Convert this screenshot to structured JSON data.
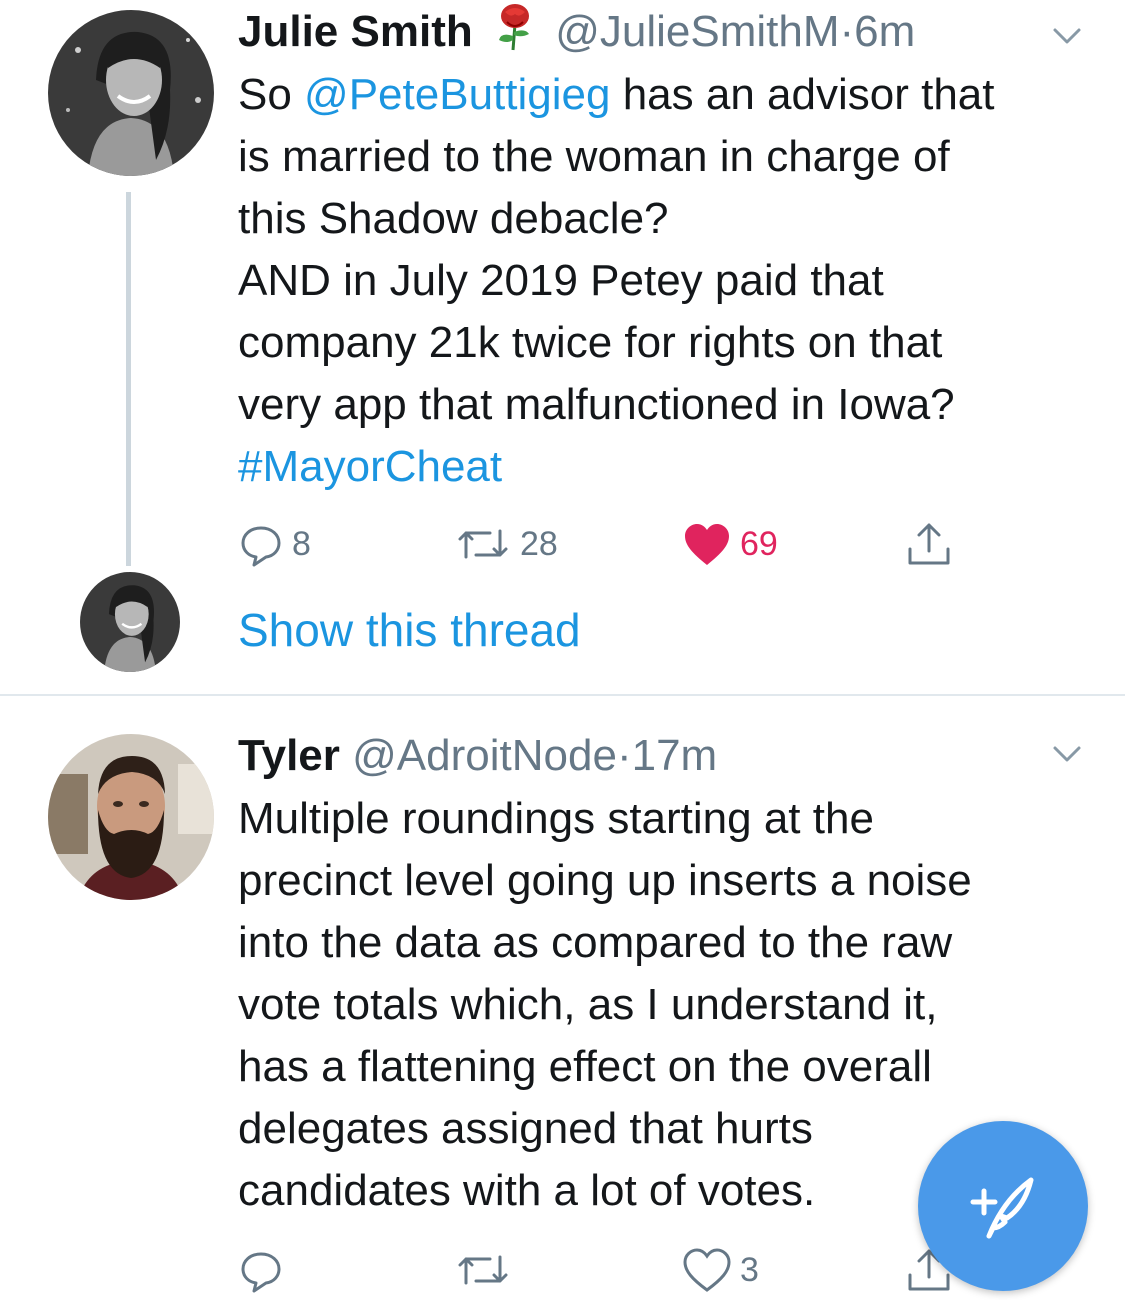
{
  "tweet1": {
    "name": "Julie Smith",
    "name_emoji": "rose-emoji",
    "handle": "@JulieSmithM",
    "separator": "·",
    "time": "6m",
    "text_lines": [
      {
        "pre": "So ",
        "mention": "@PeteButtigieg",
        "post": " has an advisor that"
      },
      "is married to the woman in charge of",
      "this Shadow debacle?",
      "AND in July 2019 Petey paid that",
      "company 21k twice for rights on that",
      "very app that malfunctioned in Iowa?"
    ],
    "hashtag": "#MayorCheat",
    "replies": "8",
    "retweets": "28",
    "likes": "69",
    "liked": true
  },
  "thread": {
    "show_thread_label": "Show this thread"
  },
  "tweet2": {
    "name": "Tyler",
    "handle": "@AdroitNode",
    "separator": "·",
    "time": "17m",
    "text_lines": [
      "Multiple roundings starting at the",
      "precinct level going up inserts a noise",
      "into the data as compared to the raw",
      "vote totals which, as I understand it,",
      "has a flattening effect on the overall",
      "delegates assigned that hurts",
      "candidates with a lot of votes."
    ],
    "replies": "",
    "retweets": "",
    "likes": "3"
  },
  "colors": {
    "accent": "#1b95e0",
    "like": "#e0245e",
    "muted": "#657786",
    "fab": "#4a99e9"
  },
  "fab": {
    "icon": "compose-tweet-icon"
  }
}
